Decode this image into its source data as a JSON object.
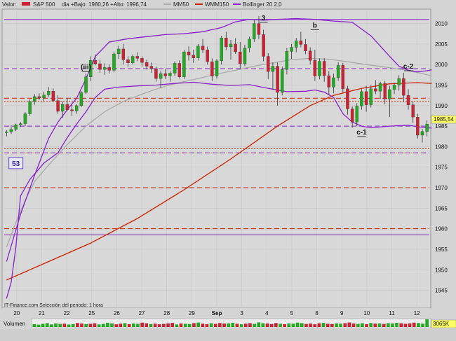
{
  "header": {
    "valor_label": "Valor:",
    "symbol": "S&P 500",
    "day_stats": "dia +Bajo: 1980,26 +Alto: 1996,74",
    "legend": [
      {
        "name": "MM50",
        "color": "#aaaaaa"
      },
      {
        "name": "WMM150",
        "color": "#cc2200"
      },
      {
        "name": "Bollinger 20 2,0",
        "color": "#8822cc"
      }
    ]
  },
  "footer": {
    "source_note": "IT-Finance.com  Selección del periodo: 1 hora",
    "volume_label": "Volumen",
    "volume_value": "3065K"
  },
  "colors": {
    "background": "#d4d4d4",
    "up_candle": "#22aa22",
    "down_candle": "#cc2233",
    "bollinger": "#8822cc",
    "mm50": "#aaaaaa",
    "wmm150": "#cc2200",
    "price_badge": "#ffff66"
  },
  "chart_data": {
    "type": "candlestick",
    "title": "S&P 500",
    "interval": "1 hora",
    "ylim": [
      1941,
      2013
    ],
    "y_ticks": [
      1945,
      1950,
      1955,
      1960,
      1965,
      1970,
      1975,
      1980,
      1985,
      1990,
      1995,
      2000,
      2005,
      2010
    ],
    "x_ticks": [
      "20",
      "21",
      "22",
      "25",
      "26",
      "27",
      "28",
      "29",
      "Sep",
      "3",
      "4",
      "5",
      "8",
      "9",
      "10",
      "11",
      "12"
    ],
    "last_price": "1985,54",
    "candles": [
      [
        1983.4,
        1984.0,
        1982.5,
        1983.6
      ],
      [
        1983.6,
        1985.2,
        1983.1,
        1984.2
      ],
      [
        1984.2,
        1985.6,
        1983.8,
        1985.3
      ],
      [
        1985.3,
        1986.0,
        1984.8,
        1985.6
      ],
      [
        1985.6,
        1988.4,
        1985.0,
        1988.0
      ],
      [
        1988.0,
        1991.5,
        1987.5,
        1991.0
      ],
      [
        1991.0,
        1992.8,
        1990.2,
        1992.2
      ],
      [
        1992.2,
        1993.0,
        1991.4,
        1991.9
      ],
      [
        1991.9,
        1993.4,
        1991.1,
        1992.6
      ],
      [
        1992.6,
        1994.5,
        1992.1,
        1993.5
      ],
      [
        1993.5,
        1994.2,
        1990.8,
        1991.2
      ],
      [
        1991.2,
        1992.5,
        1988.0,
        1988.6
      ],
      [
        1988.6,
        1991.0,
        1987.0,
        1990.3
      ],
      [
        1990.3,
        1991.8,
        1988.7,
        1989.0
      ],
      [
        1989.0,
        1990.2,
        1987.5,
        1988.7
      ],
      [
        1988.7,
        1990.4,
        1988.0,
        1990.0
      ],
      [
        1990.0,
        1993.5,
        1989.6,
        1993.2
      ],
      [
        1993.2,
        1997.8,
        1992.8,
        1997.0
      ],
      [
        1997.0,
        2002.0,
        1996.0,
        2001.0
      ],
      [
        2001.0,
        2002.5,
        1999.8,
        2000.2
      ],
      [
        2000.2,
        2001.2,
        1998.0,
        1998.8
      ],
      [
        1998.8,
        2000.3,
        1997.5,
        1999.3
      ],
      [
        1999.3,
        2000.0,
        1997.8,
        1998.6
      ],
      [
        1998.6,
        2003.2,
        1998.1,
        2002.6
      ],
      [
        2002.6,
        2004.6,
        2001.4,
        2003.8
      ],
      [
        2003.8,
        2005.0,
        2000.0,
        2001.2
      ],
      [
        2001.2,
        2002.0,
        1999.5,
        2000.4
      ],
      [
        2000.4,
        2002.5,
        2000.0,
        2002.0
      ],
      [
        2002.0,
        2003.0,
        2000.8,
        2001.5
      ],
      [
        2001.5,
        2002.0,
        1999.5,
        2000.5
      ],
      [
        2000.5,
        2001.2,
        1998.8,
        1999.6
      ],
      [
        1999.6,
        2000.5,
        1998.0,
        1999.0
      ],
      [
        1999.0,
        1999.5,
        1995.8,
        1996.6
      ],
      [
        1996.6,
        1998.5,
        1994.2,
        1997.8
      ],
      [
        1997.8,
        1999.0,
        1996.5,
        1997.2
      ],
      [
        1997.2,
        1998.4,
        1995.8,
        1997.9
      ],
      [
        1997.9,
        2000.8,
        1997.2,
        2000.3
      ],
      [
        2000.3,
        2001.0,
        1996.6,
        1997.0
      ],
      [
        1997.0,
        2003.5,
        1996.5,
        2003.1
      ],
      [
        2003.1,
        2004.4,
        2001.0,
        2002.3
      ],
      [
        2002.3,
        2003.6,
        2000.4,
        2001.6
      ],
      [
        2001.6,
        2005.0,
        2001.0,
        2004.5
      ],
      [
        2004.5,
        2006.2,
        2002.8,
        2003.6
      ],
      [
        2003.6,
        2004.4,
        2000.0,
        2000.7
      ],
      [
        2000.7,
        2001.5,
        1996.0,
        1997.2
      ],
      [
        1997.2,
        2001.4,
        1996.6,
        2000.9
      ],
      [
        2000.9,
        2007.0,
        2000.0,
        2006.5
      ],
      [
        2006.5,
        2008.0,
        2003.5,
        2004.3
      ],
      [
        2004.3,
        2006.0,
        2001.2,
        2005.0
      ],
      [
        2005.0,
        2006.4,
        2002.6,
        2003.1
      ],
      [
        2003.1,
        2005.5,
        1998.8,
        2000.2
      ],
      [
        2000.2,
        2004.8,
        1999.6,
        2004.0
      ],
      [
        2004.0,
        2006.8,
        2003.0,
        2006.2
      ],
      [
        2006.2,
        2011.0,
        2005.5,
        2010.0
      ],
      [
        2010.0,
        2011.8,
        2006.2,
        2007.3
      ],
      [
        2007.3,
        2008.5,
        2000.8,
        2002.0
      ],
      [
        2002.0,
        2002.8,
        1996.5,
        1998.3
      ],
      [
        1998.3,
        2000.5,
        1993.8,
        1999.6
      ],
      [
        1999.6,
        2000.5,
        1990.0,
        1993.2
      ],
      [
        1993.2,
        1999.5,
        1992.5,
        1998.8
      ],
      [
        1998.8,
        2004.0,
        1997.6,
        2003.2
      ],
      [
        2003.2,
        2005.0,
        2001.4,
        2004.2
      ],
      [
        2004.2,
        2006.5,
        2003.0,
        2005.8
      ],
      [
        2005.8,
        2008.0,
        2004.2,
        2004.9
      ],
      [
        2004.9,
        2006.2,
        2002.5,
        2003.3
      ],
      [
        2003.3,
        2004.2,
        2000.0,
        2001.0
      ],
      [
        2001.0,
        2003.6,
        1996.0,
        1997.2
      ],
      [
        1997.2,
        2001.5,
        1996.4,
        2000.8
      ],
      [
        2000.8,
        2001.6,
        1995.8,
        1997.3
      ],
      [
        1997.3,
        1998.4,
        1992.5,
        1994.5
      ],
      [
        1994.5,
        1997.8,
        1993.0,
        1996.8
      ],
      [
        1996.8,
        2000.6,
        1996.0,
        1999.8
      ],
      [
        1999.8,
        2000.4,
        1993.2,
        1994.1
      ],
      [
        1994.1,
        1994.8,
        1987.8,
        1989.2
      ],
      [
        1989.2,
        1989.8,
        1984.6,
        1986.0
      ],
      [
        1986.0,
        1990.6,
        1985.0,
        1989.9
      ],
      [
        1989.9,
        1994.0,
        1989.0,
        1993.4
      ],
      [
        1993.4,
        1994.8,
        1988.5,
        1990.2
      ],
      [
        1990.2,
        1995.0,
        1989.5,
        1994.1
      ],
      [
        1994.1,
        1996.2,
        1992.8,
        1993.5
      ],
      [
        1993.5,
        1995.8,
        1991.6,
        1995.4
      ],
      [
        1995.4,
        1996.0,
        1990.3,
        1991.6
      ],
      [
        1991.6,
        1994.8,
        1987.2,
        1993.9
      ],
      [
        1993.9,
        1995.6,
        1992.8,
        1995.0
      ],
      [
        1995.0,
        1997.4,
        1993.6,
        1996.6
      ],
      [
        1996.6,
        1998.0,
        1991.0,
        1992.5
      ],
      [
        1992.5,
        1994.0,
        1989.0,
        1990.2
      ],
      [
        1990.2,
        1991.0,
        1985.8,
        1987.2
      ],
      [
        1987.2,
        1988.0,
        1982.0,
        1982.8
      ],
      [
        1982.8,
        1984.3,
        1981.0,
        1983.7
      ],
      [
        1983.7,
        1986.4,
        1982.5,
        1985.5
      ]
    ],
    "series": [
      {
        "name": "MM50",
        "color": "#aaaaaa",
        "x": [
          0,
          2,
          4,
          6,
          9,
          13,
          17,
          21,
          25,
          29,
          33,
          37,
          41,
          45,
          49,
          53,
          57,
          61,
          65,
          69,
          73,
          77,
          81,
          85,
          89,
          91
        ],
        "values": [
          1955.5,
          1961.5,
          1967.0,
          1971.5,
          1975.5,
          1980.5,
          1985.0,
          1988.5,
          1991.0,
          1992.8,
          1994.4,
          1995.6,
          1996.6,
          1997.7,
          1998.6,
          1999.6,
          2000.4,
          2001.2,
          2001.5,
          2001.3,
          2000.7,
          2000.0,
          1999.4,
          1998.7,
          1997.8,
          1997.2
        ]
      },
      {
        "name": "WMM150",
        "color": "#cc2200",
        "x": [
          0,
          8,
          18,
          28,
          38,
          48,
          58,
          65,
          70,
          76,
          82,
          88,
          91
        ],
        "values": [
          1947.5,
          1951.5,
          1956.5,
          1962.5,
          1969.5,
          1977.0,
          1985.0,
          1990.0,
          1992.5,
          1994.2,
          1995.3,
          1995.6,
          1995.4
        ]
      },
      {
        "name": "Bollinger 20 2,0 upper",
        "color": "#8822cc",
        "x": [
          0,
          3,
          6,
          9,
          11,
          13,
          15,
          17,
          19,
          22,
          26,
          30,
          34,
          38,
          42,
          46,
          49,
          52,
          55,
          58,
          62,
          66,
          70,
          74,
          78,
          80,
          82,
          84,
          86,
          88,
          90,
          91
        ],
        "values": [
          1952.0,
          1963.5,
          1973.0,
          1982.0,
          1986.0,
          1989.0,
          1991.8,
          1996.5,
          2002.0,
          2005.5,
          2006.3,
          2006.8,
          2007.3,
          2007.5,
          2008.0,
          2009.0,
          2010.4,
          2011.0,
          2010.8,
          2011.0,
          2011.2,
          2011.0,
          2010.6,
          2010.3,
          2007.0,
          2004.5,
          2002.0,
          1999.6,
          1998.6,
          1998.2,
          1998.5,
          1998.7
        ]
      },
      {
        "name": "Bollinger 20 2,0 lower",
        "color": "#8822cc",
        "x": [
          0,
          1,
          2,
          3,
          5,
          8,
          11,
          13,
          15,
          17,
          19,
          21,
          24,
          28,
          32,
          36,
          40,
          44,
          48,
          52,
          56,
          60,
          64,
          66,
          68,
          70,
          72,
          74,
          76,
          78,
          82,
          86,
          89,
          91
        ],
        "values": [
          1943.0,
          1947.0,
          1955.5,
          1968.0,
          1972.0,
          1976.0,
          1978.5,
          1982.2,
          1985.5,
          1988.5,
          1992.0,
          1994.0,
          1994.5,
          1994.8,
          1995.0,
          1995.4,
          1995.7,
          1995.2,
          1994.9,
          1995.1,
          1994.2,
          1993.4,
          1993.5,
          1993.8,
          1993.3,
          1992.0,
          1988.0,
          1986.0,
          1985.0,
          1984.6,
          1985.0,
          1985.2,
          1984.7,
          1984.5
        ]
      }
    ],
    "reference_lines": [
      {
        "value": 2011.0,
        "color": "#8822cc",
        "style": "solid"
      },
      {
        "value": 1999.0,
        "color": "#8822cc",
        "style": "dashed"
      },
      {
        "value": 1991.8,
        "color": "#cc2200",
        "style": "dashed"
      },
      {
        "value": 1991.0,
        "color": "#cc2200",
        "style": "dotted"
      },
      {
        "value": 1985.0,
        "color": "#8822cc",
        "style": "dashed"
      },
      {
        "value": 1979.5,
        "color": "#cc2200",
        "style": "dotted"
      },
      {
        "value": 1978.5,
        "color": "#8822cc",
        "style": "dashed"
      },
      {
        "value": 1970.0,
        "color": "#cc2200",
        "style": "dashed"
      },
      {
        "value": 1960.0,
        "color": "#cc2200",
        "style": "dashed"
      },
      {
        "value": 1958.5,
        "color": "#8822cc",
        "style": "solid"
      }
    ],
    "annotations": [
      {
        "text": "(iii)",
        "x": 17,
        "y": 1998.8
      },
      {
        "text": "3",
        "x": 55,
        "y": 2010.8
      },
      {
        "text": "b",
        "x": 66,
        "y": 2009.0
      },
      {
        "text": "c-1",
        "x": 76,
        "y": 1983.0
      },
      {
        "text": "c-2",
        "x": 86,
        "y": 1999.0
      },
      {
        "text": "53",
        "x": 2,
        "y": 1976.0,
        "boxed": true
      }
    ],
    "volume": [
      22,
      18,
      25,
      30,
      20,
      28,
      24,
      26,
      19,
      23,
      31,
      27,
      22,
      25,
      29,
      20,
      24,
      33,
      28,
      21,
      26,
      30,
      22,
      27,
      25,
      34,
      29,
      23,
      26,
      21,
      24,
      28,
      32,
      20,
      27,
      25,
      23,
      30,
      35,
      26,
      22,
      29,
      24,
      31,
      27,
      28,
      33,
      25,
      21,
      26,
      30,
      24,
      36,
      29,
      27,
      23,
      31,
      25,
      22,
      28,
      26,
      34,
      30,
      24,
      27,
      21,
      29,
      32,
      25,
      23,
      28,
      26,
      30,
      35,
      27,
      24,
      29,
      22,
      31,
      26,
      28,
      24,
      30,
      27,
      33,
      29,
      25,
      28,
      34,
      31,
      26,
      60
    ]
  }
}
